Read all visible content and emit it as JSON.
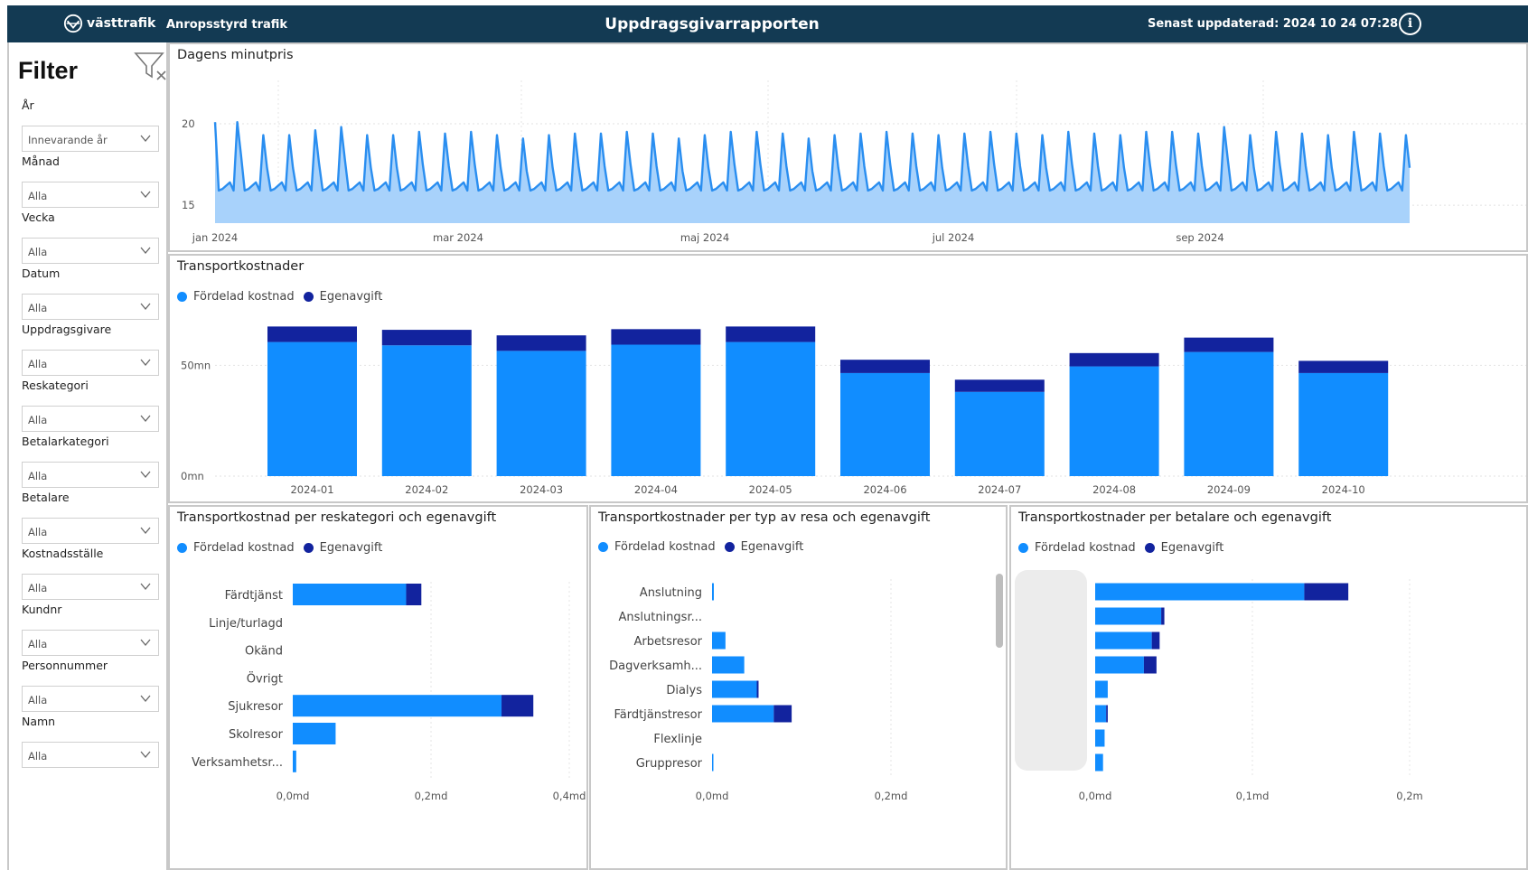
{
  "header": {
    "logo_text": "västtrafik",
    "subtitle": "Anropsstyrd trafik",
    "title": "Uppdragsgivarrapporten",
    "updated": "Senast uppdaterad: 2024 10 24 07:28",
    "info_icon": "info-icon"
  },
  "filter": {
    "title": "Filter",
    "clear_icon": "clear-filter-icon",
    "items": [
      {
        "label": "År",
        "value": "Innevarande år"
      },
      {
        "label": "Månad",
        "value": "Alla"
      },
      {
        "label": "Vecka",
        "value": "Alla"
      },
      {
        "label": "Datum",
        "value": "Alla"
      },
      {
        "label": "Uppdragsgivare",
        "value": "Alla"
      },
      {
        "label": "Reskategori",
        "value": "Alla"
      },
      {
        "label": "Betalarkategori",
        "value": "Alla"
      },
      {
        "label": "Betalare",
        "value": "Alla"
      },
      {
        "label": "Kostnadsställe",
        "value": "Alla"
      },
      {
        "label": "Kundnr",
        "value": "Alla"
      },
      {
        "label": "Personnummer",
        "value": "Alla"
      },
      {
        "label": "Namn",
        "value": "Alla"
      }
    ]
  },
  "colors": {
    "fordelad": "#118dff",
    "egenavgift": "#12239e",
    "area_fill": "#a8d2fb",
    "line": "#2a8ef0"
  },
  "legend": {
    "fordelad": "Fördelad kostnad",
    "egenavgift": "Egenavgift"
  },
  "chart_data": [
    {
      "type": "area",
      "title": "Dagens minutpris",
      "x_ticks": [
        "jan 2024",
        "mar 2024",
        "maj 2024",
        "jul 2024",
        "sep 2024"
      ],
      "y_ticks": [
        "20",
        "15"
      ],
      "ylim": [
        13.9,
        21
      ],
      "weekly_peaks": [
        20.1,
        19.3,
        19.3,
        19.6,
        19.8,
        19.3,
        19.3,
        19.5,
        19.4,
        19.5,
        19.3,
        19.1,
        19.3,
        19.4,
        19.4,
        19.5,
        19.4,
        19.1,
        19.3,
        19.5,
        19.5,
        19.4,
        19.1,
        19.3,
        19.4,
        19.5,
        19.4,
        19.3,
        19.4,
        19.5,
        19.4,
        19.3,
        19.5,
        19.4,
        19.3,
        19.5,
        19.5,
        19.4,
        19.8,
        19.3,
        19.5,
        19.4,
        19.3,
        19.5,
        19.4,
        19.3
      ],
      "baseline": 15.7,
      "series_name": "Dagens minutpris"
    },
    {
      "type": "bar",
      "title": "Transportkostnader",
      "categories": [
        "2024-01",
        "2024-02",
        "2024-03",
        "2024-04",
        "2024-05",
        "2024-06",
        "2024-07",
        "2024-08",
        "2024-09",
        "2024-10"
      ],
      "series": [
        {
          "name": "Fördelad kostnad",
          "values": [
            60.5,
            59,
            56.5,
            59.3,
            60.5,
            46.5,
            38,
            49.5,
            56,
            46.5
          ]
        },
        {
          "name": "Egenavgift",
          "values": [
            7,
            7,
            7,
            7,
            7,
            6,
            5.5,
            6,
            6.5,
            5.5
          ]
        }
      ],
      "y_ticks": [
        "50mn",
        "0mn"
      ],
      "ylim": [
        0,
        75
      ]
    },
    {
      "type": "bar",
      "orientation": "horizontal",
      "title": "Transportkostnad per reskategori och egenavgift",
      "categories": [
        "Färdtjänst",
        "Linje/turlagd",
        "Okänd",
        "Övrigt",
        "Sjukresor",
        "Skolresor",
        "Verksamhetsr..."
      ],
      "series": [
        {
          "name": "Fördelad kostnad",
          "values": [
            0.164,
            0,
            0,
            0,
            0.302,
            0.062,
            0.005
          ]
        },
        {
          "name": "Egenavgift",
          "values": [
            0.022,
            0,
            0,
            0,
            0.046,
            0,
            0
          ]
        }
      ],
      "x_ticks": [
        "0,0md",
        "0,2md",
        "0,4md"
      ],
      "xlim": [
        0,
        0.4
      ]
    },
    {
      "type": "bar",
      "orientation": "horizontal",
      "title": "Transportkostnader per typ av resa och egenavgift",
      "categories": [
        "Anslutning",
        "Anslutningsr...",
        "Arbetsresor",
        "Dagverksamh...",
        "Dialys",
        "Färdtjänstresor",
        "Flexlinje",
        "Gruppresor"
      ],
      "series": [
        {
          "name": "Fördelad kostnad",
          "values": [
            0.002,
            0,
            0.015,
            0.036,
            0.05,
            0.069,
            0,
            0.001
          ]
        },
        {
          "name": "Egenavgift",
          "values": [
            0,
            0,
            0,
            0,
            0.002,
            0.02,
            0,
            0
          ]
        }
      ],
      "x_ticks": [
        "0,0md",
        "0,2md"
      ],
      "xlim": [
        0,
        0.2
      ]
    },
    {
      "type": "bar",
      "orientation": "horizontal",
      "title": "Transportkostnader per betalare och egenavgift",
      "categories": [
        "",
        "",
        "",
        "",
        "",
        "",
        "",
        ""
      ],
      "series": [
        {
          "name": "Fördelad kostnad",
          "values": [
            0.133,
            0.042,
            0.036,
            0.031,
            0.008,
            0.007,
            0.006,
            0.005
          ]
        },
        {
          "name": "Egenavgift",
          "values": [
            0.028,
            0.002,
            0.005,
            0.008,
            0,
            0.001,
            0,
            0
          ]
        }
      ],
      "x_ticks": [
        "0,0md",
        "0,1md",
        "0,2m"
      ],
      "xlim": [
        0,
        0.2
      ]
    }
  ]
}
